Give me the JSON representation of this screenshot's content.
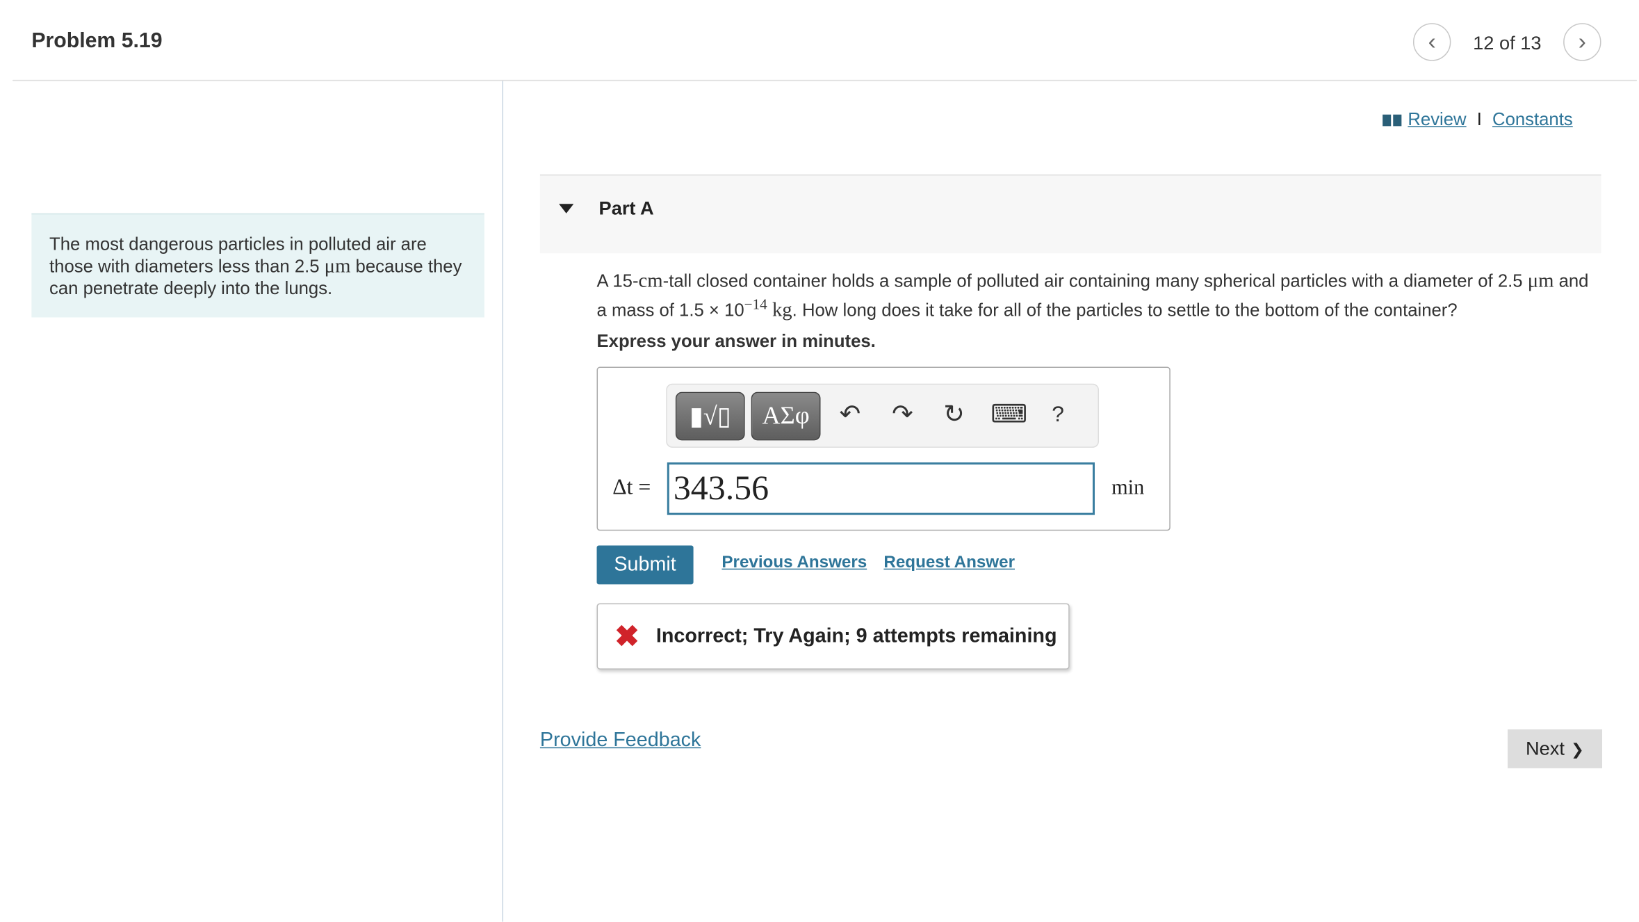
{
  "header": {
    "title": "Problem 5.19",
    "counter": "12 of 13",
    "prev_icon": "chevron-left-icon",
    "next_icon": "chevron-right-icon"
  },
  "intro": {
    "text_before": "The most dangerous particles in polluted air are those with diameters less than 2.5 ",
    "unit": "μm",
    "text_after": " because they can penetrate deeply into the lungs."
  },
  "links": {
    "review": " Review",
    "separator": "I",
    "constants": "Constants",
    "review_icon": "book-icon"
  },
  "part": {
    "label": "Part A"
  },
  "question": {
    "t1": "A 15-",
    "u1": "cm",
    "t2": "-tall closed container holds a sample of polluted air containing many spherical particles with a diameter of 2.5 ",
    "u2": "μm",
    "t3": " and a mass of 1.5 × 10",
    "exp": "−14",
    "u3": " kg",
    "t4": ". How long does it take for all of the particles to settle to the bottom of the container?"
  },
  "instruction": "Express your answer in minutes.",
  "toolbar": {
    "templates": "▮√▯",
    "greek": "ΑΣφ",
    "undo": "↶",
    "redo": "↷",
    "reset": "↻",
    "keyboard": "⌨",
    "help": "?"
  },
  "answer": {
    "label": "Δt =",
    "value": "343.56",
    "unit": "min"
  },
  "actions": {
    "submit": "Submit",
    "previous_answers": "Previous Answers",
    "request_answer": "Request Answer"
  },
  "feedback": {
    "icon": "✖",
    "message": "Incorrect; Try Again; 9 attempts remaining",
    "color": "#d0232a"
  },
  "footer": {
    "provide_feedback": "Provide Feedback",
    "next": "Next",
    "next_icon": "❯"
  }
}
